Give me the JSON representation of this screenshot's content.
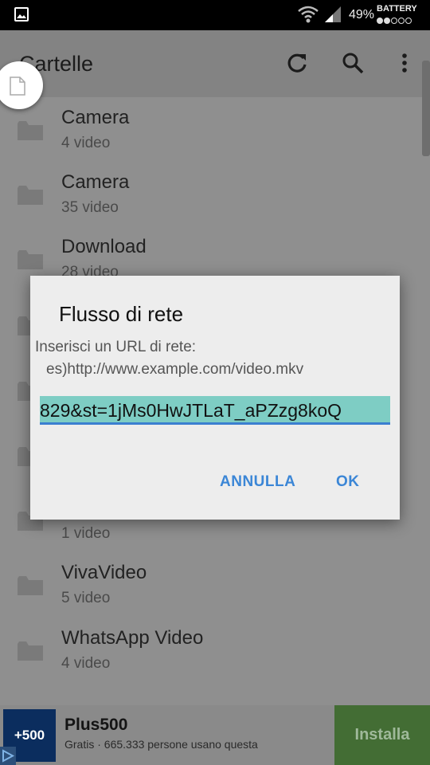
{
  "status_bar": {
    "battery_percent": "49%",
    "battery_label": "BATTERY"
  },
  "app_bar": {
    "title": "Cartelle",
    "refresh_icon": "refresh-icon",
    "search_icon": "search-icon",
    "overflow_icon": "more-vert-icon"
  },
  "folders": [
    {
      "name": "Camera",
      "count": "4 video"
    },
    {
      "name": "Camera",
      "count": "35 video"
    },
    {
      "name": "Download",
      "count": "28 video"
    },
    {
      "name": "",
      "count": ""
    },
    {
      "name": "",
      "count": ""
    },
    {
      "name": "",
      "count": ""
    },
    {
      "name": "",
      "count": "1 video"
    },
    {
      "name": "VivaVideo",
      "count": "5 video"
    },
    {
      "name": "WhatsApp Video",
      "count": "4 video"
    }
  ],
  "dialog": {
    "title": "Flusso di rete",
    "message_line1": "Inserisci un URL di rete:",
    "message_line2": "es)http://www.example.com/video.mkv",
    "input_value": "829&st=1jMs0HwJTLaT_aPZzg8koQ",
    "cancel_label": "ANNULLA",
    "ok_label": "OK",
    "accent_color": "#3b86d6"
  },
  "ad": {
    "logo_text": "+500",
    "title": "Plus500",
    "subtitle": "Gratis · 665.333 persone usano questa",
    "install_label": "Installa",
    "install_color": "#436d34"
  }
}
